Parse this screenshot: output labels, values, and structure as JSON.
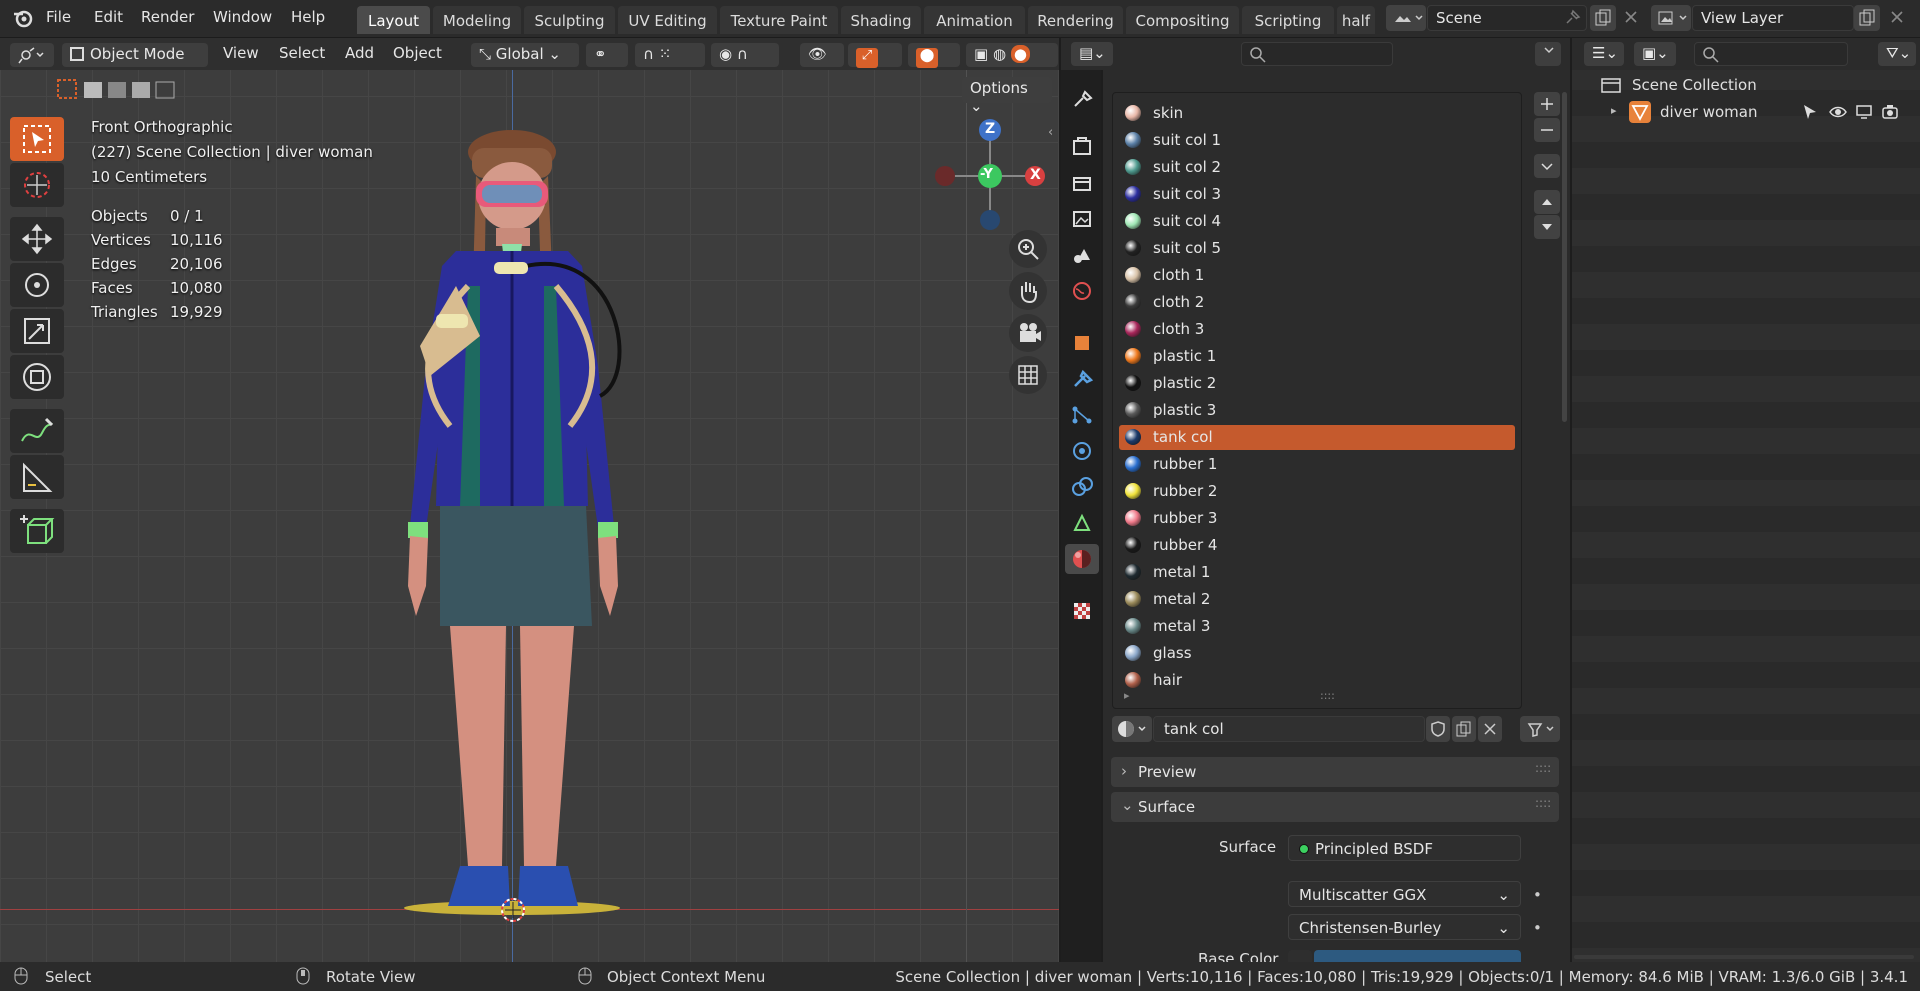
{
  "menubar": {
    "items": [
      "File",
      "Edit",
      "Render",
      "Window",
      "Help"
    ],
    "workspaces": [
      "Layout",
      "Modeling",
      "Sculpting",
      "UV Editing",
      "Texture Paint",
      "Shading",
      "Animation",
      "Rendering",
      "Compositing",
      "Scripting",
      "half"
    ],
    "scene": "Scene",
    "view_layer": "View Layer"
  },
  "viewport": {
    "mode": "Object Mode",
    "menus": [
      "View",
      "Select",
      "Add",
      "Object"
    ],
    "orientation": "Global",
    "options": "Options",
    "overlay_lines": [
      "Front Orthographic",
      "(227) Scene Collection | diver woman",
      "10 Centimeters"
    ],
    "stats": [
      {
        "k": "Objects",
        "v": "0 / 1"
      },
      {
        "k": "Vertices",
        "v": "10,116"
      },
      {
        "k": "Edges",
        "v": "20,106"
      },
      {
        "k": "Faces",
        "v": "10,080"
      },
      {
        "k": "Triangles",
        "v": "19,929"
      }
    ],
    "gizmo": {
      "z": "Z",
      "y": "-Y",
      "x": "X"
    }
  },
  "materials": {
    "items": [
      {
        "name": "skin",
        "color": "#e8b7a8"
      },
      {
        "name": "suit col 1",
        "color": "#5a7fa6"
      },
      {
        "name": "suit col 2",
        "color": "#4e9a8e"
      },
      {
        "name": "suit col 3",
        "color": "#2c2fa0"
      },
      {
        "name": "suit col 4",
        "color": "#9fe6b4"
      },
      {
        "name": "suit col 5",
        "color": "#222222"
      },
      {
        "name": "cloth 1",
        "color": "#d8c2a8"
      },
      {
        "name": "cloth 2",
        "color": "#3a3a3a"
      },
      {
        "name": "cloth 3",
        "color": "#a8265a"
      },
      {
        "name": "plastic 1",
        "color": "#f07a1e"
      },
      {
        "name": "plastic 2",
        "color": "#121212"
      },
      {
        "name": "plastic 3",
        "color": "#5a5a5a"
      },
      {
        "name": "tank col",
        "color": "#1c3a6a"
      },
      {
        "name": "rubber 1",
        "color": "#2a6fd0"
      },
      {
        "name": "rubber 2",
        "color": "#f0e23a"
      },
      {
        "name": "rubber 3",
        "color": "#f07a8a"
      },
      {
        "name": "rubber 4",
        "color": "#1a1a1a"
      },
      {
        "name": "metal 1",
        "color": "#1e2a30"
      },
      {
        "name": "metal 2",
        "color": "#9a8a5a"
      },
      {
        "name": "metal 3",
        "color": "#6a8a8a"
      },
      {
        "name": "glass",
        "color": "#8aa6c8"
      },
      {
        "name": "hair",
        "color": "#b0604a"
      }
    ],
    "selected": "tank col",
    "active_name": "tank col",
    "panels": {
      "preview": "Preview",
      "surface": "Surface"
    },
    "surface_label": "Surface",
    "surface_value": "Principled BSDF",
    "distribution": "Multiscatter GGX",
    "subsurface": "Christensen-Burley",
    "base_color_label": "Base Color",
    "base_color": "#2d5a80"
  },
  "outliner": {
    "root": "Scene Collection",
    "object": "diver woman"
  },
  "statusbar": {
    "select": "Select",
    "rotate": "Rotate View",
    "context": "Object Context Menu",
    "info": "Scene Collection | diver woman | Verts:10,116 | Faces:10,080 | Tris:19,929 | Objects:0/1 | Memory: 84.6 MiB | VRAM: 1.3/6.0 GiB | 3.4.1"
  }
}
